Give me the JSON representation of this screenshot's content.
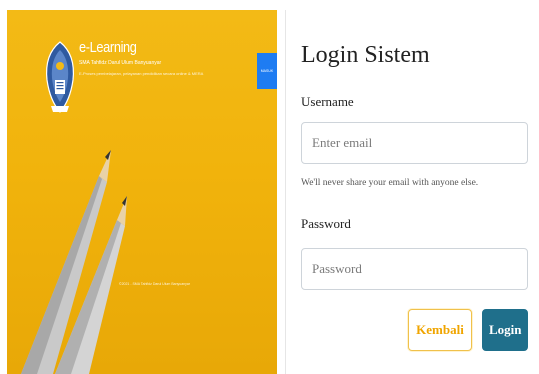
{
  "left_panel": {
    "app_title": "e-Learning",
    "school_name": "SMA Tahfidz Darul Ulum Banyuanyar",
    "tagline": "E-Proses pembelajaran, pelayanan pendidikan secara online & MERA",
    "masuk_label": "MASUK",
    "footer_text": "©2021 - SMA Tahfidz Darul Ulum Banyuanyar"
  },
  "form": {
    "title": "Login Sistem",
    "username_label": "Username",
    "email_placeholder": "Enter email",
    "email_help": "We'll never share your email with anyone else.",
    "password_label": "Password",
    "password_placeholder": "Password",
    "back_button": "Kembali",
    "login_button": "Login"
  },
  "colors": {
    "background_yellow": "#f1b30c",
    "masuk_blue": "#1e7cf2",
    "login_teal": "#1f6f8b",
    "back_outline": "#f0c14b"
  }
}
